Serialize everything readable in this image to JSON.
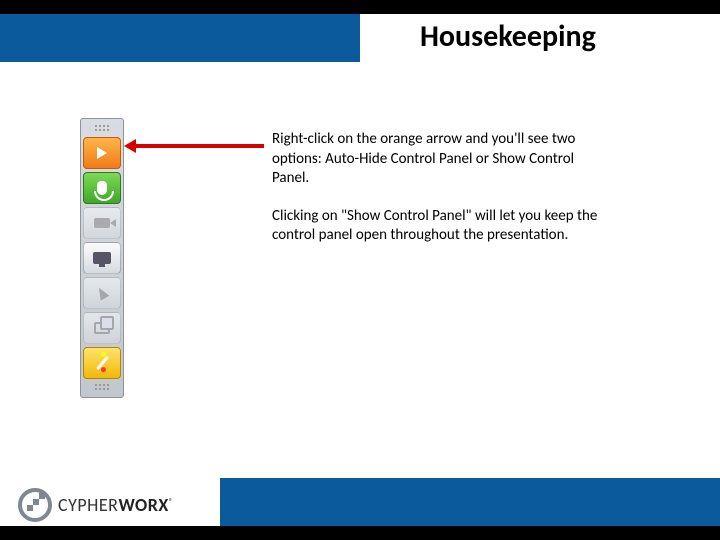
{
  "title": "Housekeeping",
  "para1": "Right-click on the orange arrow and  you'll see two options: Auto-Hide Control Panel or Show Control Panel.",
  "para2": "Clicking on \"Show Control Panel\" will let you keep the control panel open throughout the presentation.",
  "logo": {
    "part1": "CYPHER",
    "part2": "WORX"
  }
}
